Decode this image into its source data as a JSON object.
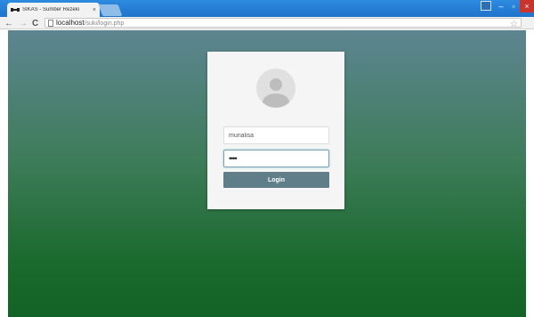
{
  "browser": {
    "tab_title": "SIKAS - Sumber Rezeki",
    "tab_close": "×",
    "url_host": "localhost",
    "url_path": "/suki/login.php",
    "nav_back": "←",
    "nav_forward": "→",
    "nav_reload": "C",
    "star": "☆",
    "win_minimize": "–",
    "win_restore": "▫",
    "win_close": "×"
  },
  "login": {
    "username_value": "munalisa",
    "password_value": "••••",
    "button_label": "Login"
  },
  "colors": {
    "titlebar": "#2d8be0",
    "button": "#5f7e8a",
    "bg_top": "#5d8591",
    "bg_bottom": "#136226",
    "close": "#c9342c"
  },
  "icons": [
    "favicon-icon",
    "back-arrow-icon",
    "forward-arrow-icon",
    "reload-icon",
    "page-icon",
    "star-icon",
    "user-avatar-icon"
  ]
}
